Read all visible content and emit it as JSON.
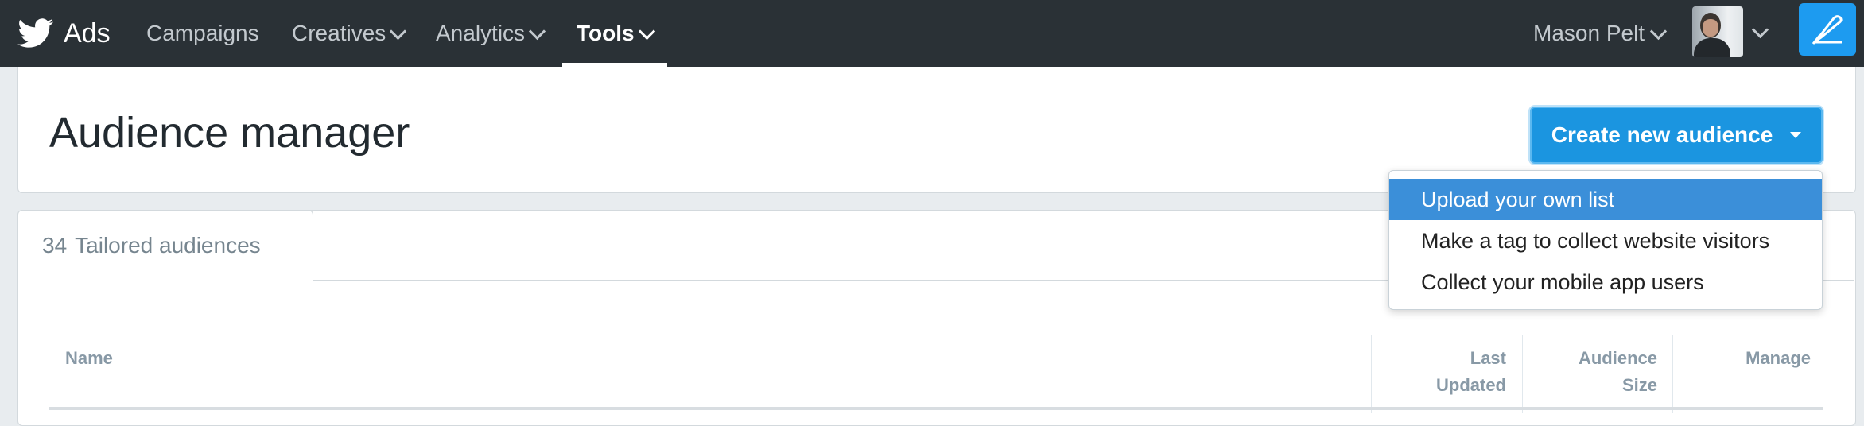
{
  "nav": {
    "brand": "Ads",
    "items": [
      {
        "label": "Campaigns",
        "has_menu": false,
        "active": false
      },
      {
        "label": "Creatives",
        "has_menu": true,
        "active": false
      },
      {
        "label": "Analytics",
        "has_menu": true,
        "active": false
      },
      {
        "label": "Tools",
        "has_menu": true,
        "active": true
      }
    ],
    "user_name": "Mason Pelt",
    "icons": {
      "brand": "twitter-bird-icon",
      "compose": "compose-tweet-icon",
      "chevron": "chevron-down-icon"
    }
  },
  "header": {
    "title": "Audience manager",
    "create_button_label": "Create new audience"
  },
  "dropdown": {
    "items": [
      {
        "label": "Upload your own list",
        "highlighted": true
      },
      {
        "label": "Make a tag to collect website visitors",
        "highlighted": false
      },
      {
        "label": "Collect your mobile app users",
        "highlighted": false
      }
    ]
  },
  "tabs": {
    "count": "34",
    "label": "Tailored audiences"
  },
  "table": {
    "columns": [
      {
        "line1": "Name",
        "line2": ""
      },
      {
        "line1": "Last",
        "line2": "Updated"
      },
      {
        "line1": "Audience",
        "line2": "Size"
      },
      {
        "line1": "Manage",
        "line2": ""
      }
    ]
  },
  "colors": {
    "topbar": "#2a3136",
    "accent": "#1b95e0",
    "dropdown_highlight": "#3b8fd9"
  }
}
